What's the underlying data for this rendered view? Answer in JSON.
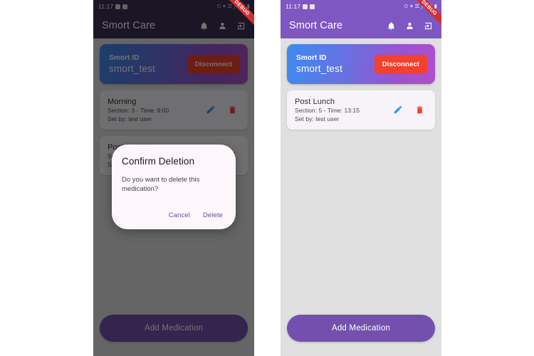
{
  "status_bar": {
    "time": "11:17",
    "battery": "26",
    "icons": [
      "check-app-icon",
      "photo-app-icon",
      "alarm-icon",
      "wifi-icon",
      "signal-icon",
      "signal-bars-icon",
      "battery-icon"
    ]
  },
  "app_bar": {
    "title": "Smort Care",
    "actions": [
      "notifications-icon",
      "profile-icon",
      "logout-icon"
    ]
  },
  "debug_ribbon": {
    "label": "DEBUG"
  },
  "id_card": {
    "label": "Smort ID",
    "value": "smort_test",
    "disconnect_label": "Disconnect",
    "gradient_start": "#3d8bf0",
    "gradient_end": "#b050cc",
    "disconnect_color": "#f4402e"
  },
  "medications_left": [
    {
      "title": "Morning",
      "schedule": "Section: 3 - Time: 9:00",
      "set_by": "Set by: test user"
    },
    {
      "title": "Post Lunch",
      "schedule": "Section: 5 - Time: 13:15",
      "set_by": "Set by: test user"
    }
  ],
  "medications_right": [
    {
      "title": "Post Lunch",
      "schedule": "Section: 5 - Time: 13:15",
      "set_by": "Set by: test user"
    }
  ],
  "row_icons": {
    "edit": "edit-pencil-icon",
    "delete": "delete-trash-icon",
    "edit_color": "#2196f3",
    "delete_color": "#f4402e"
  },
  "bottom": {
    "add_label": "Add Medication",
    "button_color": "#7350ad"
  },
  "dialog": {
    "title": "Confirm Deletion",
    "message": "Do you want to delete this medication?",
    "cancel_label": "Cancel",
    "delete_label": "Delete",
    "action_color": "#6a4fa0"
  },
  "theme": {
    "app_bar_purple": "#7e57c2",
    "screen_background": "#e0e0e0",
    "card_background": "#f7f4f9"
  }
}
